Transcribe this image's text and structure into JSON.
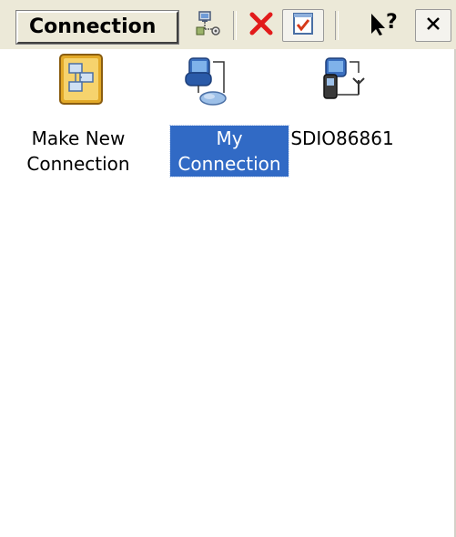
{
  "toolbar": {
    "title": "Connection",
    "buttons": [
      {
        "name": "properties-icon"
      },
      {
        "name": "delete-icon"
      },
      {
        "name": "checklist-icon"
      },
      {
        "name": "whats-this-help-icon"
      },
      {
        "name": "close-icon"
      }
    ],
    "colors": {
      "delete": "#e21b1b",
      "selection": "#316ac5",
      "toolbar_bg": "#ece9d8"
    }
  },
  "items": [
    {
      "label": "Make New\nConnection",
      "icon": "make-new-connection-icon",
      "selected": false
    },
    {
      "label": "My\nConnection",
      "icon": "network-connection-icon",
      "selected": true
    },
    {
      "label": "SDIO86861",
      "icon": "wireless-connection-icon",
      "selected": false
    }
  ]
}
